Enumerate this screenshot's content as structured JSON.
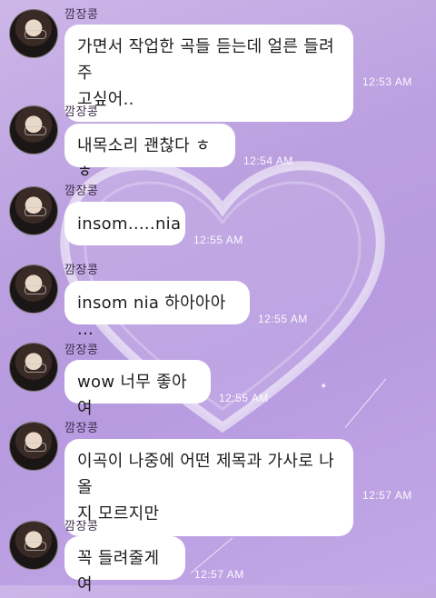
{
  "chat": {
    "messages": [
      {
        "sender": "깜장콩",
        "lines": [
          "가면서 작업한 곡들 듣는데 얼른 들려주",
          "고싶어.."
        ],
        "time": "12:53 AM"
      },
      {
        "sender": "깜장콩",
        "lines": [
          "내목소리 괜찮다 ㅎㅎ"
        ],
        "time": "12:54 AM"
      },
      {
        "sender": "깜장콩",
        "lines": [
          "insom.....nia"
        ],
        "time": "12:55 AM"
      },
      {
        "sender": "깜장콩",
        "lines": [
          "insom nia 하아아아 ..."
        ],
        "time": "12:55 AM"
      },
      {
        "sender": "깜장콩",
        "lines": [
          "wow 너무 좋아여"
        ],
        "time": "12:55 AM"
      },
      {
        "sender": "깜장콩",
        "lines": [
          "이곡이 나중에 어떤 제목과 가사로 나올",
          "지 모르지만"
        ],
        "time": "12:57 AM"
      },
      {
        "sender": "깜장콩",
        "lines": [
          "꼭 들려줄게여"
        ],
        "time": "12:57 AM"
      }
    ]
  },
  "decor": {
    "background_colors": [
      "#cdb6e8",
      "#b79ae0"
    ],
    "heart_stroke": "#f3eaff"
  }
}
